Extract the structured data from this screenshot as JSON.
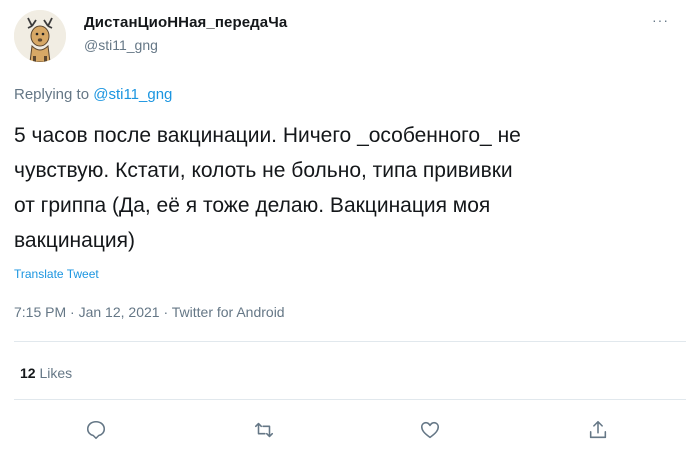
{
  "user": {
    "display_name": "ДистанЦиоННая_передаЧа",
    "handle": "@sti11_gng"
  },
  "more_icon": "···",
  "reply": {
    "prefix": "Replying to",
    "mention": "@sti11_gng"
  },
  "tweet": {
    "lines": [
      "5 часов после вакцинации. Ничего _особенного_ не",
      "чувствую. Кстати, колоть не больно, типа прививки",
      "от гриппа (Да, её я тоже делаю. Вакцинация моя",
      "вакцинация)"
    ]
  },
  "translate_label": "Translate Tweet",
  "meta": {
    "time": "7:15 PM",
    "separator": "·",
    "date": "Jan 12, 2021",
    "source": "Twitter for Android"
  },
  "stats": {
    "likes_count": "12",
    "likes_label": "Likes"
  },
  "actions": [
    {
      "icon": "reply-icon"
    },
    {
      "icon": "retweet-icon"
    },
    {
      "icon": "like-icon"
    },
    {
      "icon": "share-icon"
    }
  ],
  "colors": {
    "link": "#1b95e0",
    "secondary_text": "#657786",
    "primary_text": "#14171a",
    "divider": "#e1e8ed"
  }
}
